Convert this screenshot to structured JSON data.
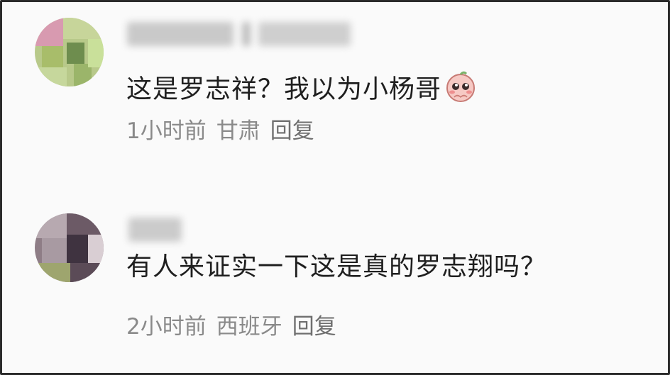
{
  "comments": [
    {
      "text": "这是罗志祥？我以为小杨哥",
      "emoji": "blushing-peach-face-emoji",
      "time": "1小时前",
      "location": "甘肃",
      "reply_label": "回复"
    },
    {
      "text": "有人来证实一下这是真的罗志翔吗？",
      "time": "2小时前",
      "location": "西班牙",
      "reply_label": "回复"
    }
  ]
}
